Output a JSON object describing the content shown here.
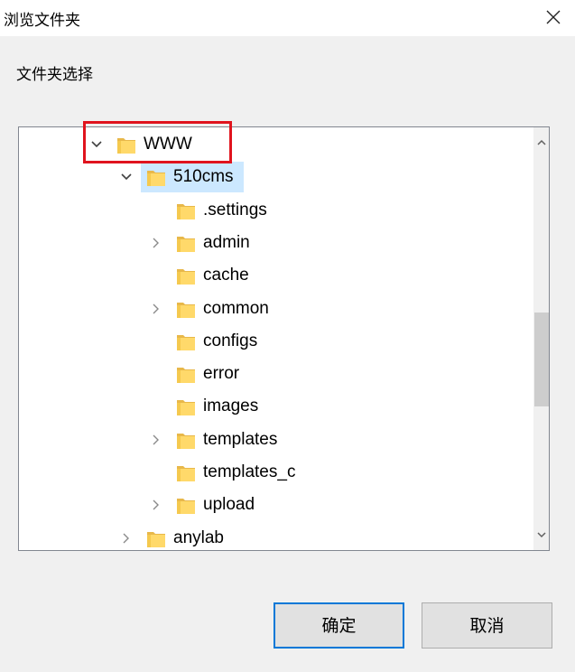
{
  "dialog": {
    "title": "浏览文件夹",
    "close_icon": "close-icon",
    "prompt": "文件夹选择"
  },
  "tree": {
    "items": [
      {
        "label": "WWW",
        "expanded": true,
        "has_children": true,
        "depth": 0
      },
      {
        "label": "510cms",
        "expanded": true,
        "has_children": true,
        "depth": 1,
        "selected": true
      },
      {
        "label": ".settings",
        "has_children": false,
        "depth": 2
      },
      {
        "label": "admin",
        "has_children": true,
        "expanded": false,
        "depth": 2
      },
      {
        "label": "cache",
        "has_children": false,
        "depth": 2
      },
      {
        "label": "common",
        "has_children": true,
        "expanded": false,
        "depth": 2
      },
      {
        "label": "configs",
        "has_children": false,
        "depth": 2
      },
      {
        "label": "error",
        "has_children": false,
        "depth": 2
      },
      {
        "label": "images",
        "has_children": false,
        "depth": 2
      },
      {
        "label": "templates",
        "has_children": true,
        "expanded": false,
        "depth": 2
      },
      {
        "label": "templates_c",
        "has_children": false,
        "depth": 2
      },
      {
        "label": "upload",
        "has_children": true,
        "expanded": false,
        "depth": 2
      },
      {
        "label": "anylab",
        "has_children": true,
        "expanded": false,
        "depth": 1
      }
    ],
    "selection_color": "#cce8ff",
    "annotation_color": "#e0141e"
  },
  "buttons": {
    "ok_label": "确定",
    "cancel_label": "取消",
    "accent": "#0078d7"
  }
}
